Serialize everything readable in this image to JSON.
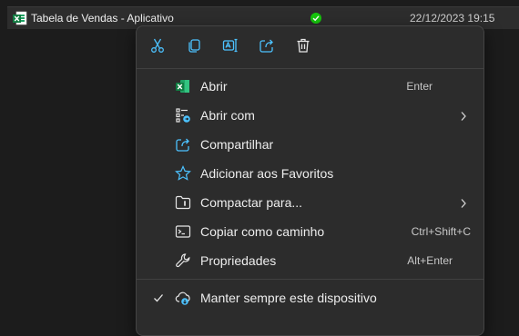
{
  "file": {
    "name": "Tabela de Vendas - Aplicativo",
    "date": "22/12/2023 19:15"
  },
  "toolbar": {
    "buttons": [
      {
        "name": "cut",
        "icon": "scissors-icon"
      },
      {
        "name": "copy",
        "icon": "copy-icon"
      },
      {
        "name": "rename",
        "icon": "rename-icon"
      },
      {
        "name": "share",
        "icon": "share-icon"
      },
      {
        "name": "delete",
        "icon": "trash-icon"
      }
    ]
  },
  "menu": {
    "open": {
      "label": "Abrir",
      "shortcut": "Enter"
    },
    "open_with": {
      "label": "Abrir com"
    },
    "share": {
      "label": "Compartilhar"
    },
    "favorites": {
      "label": "Adicionar aos Favoritos"
    },
    "compress": {
      "label": "Compactar para..."
    },
    "copy_path": {
      "label": "Copiar como caminho",
      "shortcut": "Ctrl+Shift+C"
    },
    "properties": {
      "label": "Propriedades",
      "shortcut": "Alt+Enter"
    },
    "keep_on_device": {
      "label": "Manter sempre este dispositivo",
      "checked": true
    }
  },
  "colors": {
    "accent": "#4cc2ff",
    "excel_green": "#107c41",
    "status_green": "#16c60c"
  }
}
